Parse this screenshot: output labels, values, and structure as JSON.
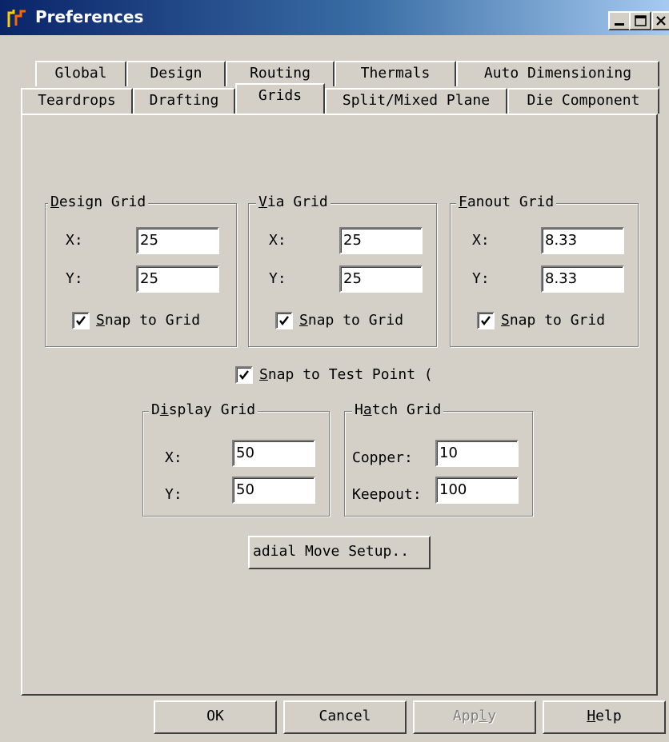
{
  "window": {
    "title": "Preferences",
    "icons": [
      "app-logo-icon",
      "minimize-icon",
      "maximize-icon",
      "close-icon"
    ]
  },
  "tabs": {
    "row1": [
      "Global",
      "Design",
      "Routing",
      "Thermals",
      "Auto Dimensioning"
    ],
    "row2": [
      "Teardrops",
      "Drafting",
      "Grids",
      "Split/Mixed Plane",
      "Die Component"
    ],
    "active": "Grids"
  },
  "design_grid": {
    "legend_mn": "D",
    "legend_rest": "esign Grid",
    "x_label": "X:",
    "y_label": "Y:",
    "x": "25",
    "y": "25",
    "snap_mn": "S",
    "snap_rest": "nap to Grid",
    "snap": true
  },
  "via_grid": {
    "legend_mn": "V",
    "legend_rest": "ia Grid",
    "x_label": "X:",
    "y_label": "Y:",
    "x": "25",
    "y": "25",
    "snap_mn": "S",
    "snap_rest": "nap to Grid",
    "snap": true
  },
  "fanout_grid": {
    "legend_mn": "F",
    "legend_rest": "anout Grid",
    "x_label": "X:",
    "y_label": "Y:",
    "x": "8.33",
    "y": "8.33",
    "snap_mn": "S",
    "snap_rest": "nap to Grid",
    "snap": true
  },
  "snap_test_point": {
    "mn": "S",
    "rest": "nap to Test Point (",
    "checked": true
  },
  "display_grid": {
    "legend_pre": "D",
    "legend_mn": "i",
    "legend_rest": "splay Grid",
    "x_label": "X:",
    "y_label": "Y:",
    "x": "50",
    "y": "50"
  },
  "hatch_grid": {
    "legend_pre": "H",
    "legend_mn": "a",
    "legend_rest": "tch Grid",
    "copper_label": "Copper:",
    "keepout_label": "Keepout:",
    "copper": "10",
    "keepout": "100"
  },
  "radial_button": "adial Move Setup..",
  "buttons": {
    "ok": "OK",
    "cancel": "Cancel",
    "apply_pre": "App",
    "apply_mn": "l",
    "apply_rest": "y",
    "help_mn": "H",
    "help_rest": "elp"
  }
}
